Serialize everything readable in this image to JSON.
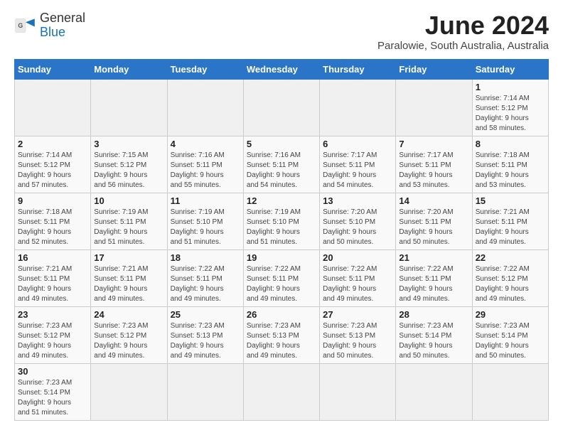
{
  "header": {
    "logo_line1": "General",
    "logo_line2": "Blue",
    "title": "June 2024",
    "subtitle": "Paralowie, South Australia, Australia"
  },
  "days_of_week": [
    "Sunday",
    "Monday",
    "Tuesday",
    "Wednesday",
    "Thursday",
    "Friday",
    "Saturday"
  ],
  "weeks": [
    [
      {
        "day": "",
        "info": ""
      },
      {
        "day": "",
        "info": ""
      },
      {
        "day": "",
        "info": ""
      },
      {
        "day": "",
        "info": ""
      },
      {
        "day": "",
        "info": ""
      },
      {
        "day": "",
        "info": ""
      },
      {
        "day": "1",
        "info": "Sunrise: 7:14 AM\nSunset: 5:12 PM\nDaylight: 9 hours\nand 58 minutes."
      }
    ],
    [
      {
        "day": "2",
        "info": "Sunrise: 7:14 AM\nSunset: 5:12 PM\nDaylight: 9 hours\nand 57 minutes."
      },
      {
        "day": "3",
        "info": "Sunrise: 7:15 AM\nSunset: 5:12 PM\nDaylight: 9 hours\nand 56 minutes."
      },
      {
        "day": "4",
        "info": "Sunrise: 7:16 AM\nSunset: 5:11 PM\nDaylight: 9 hours\nand 55 minutes."
      },
      {
        "day": "5",
        "info": "Sunrise: 7:16 AM\nSunset: 5:11 PM\nDaylight: 9 hours\nand 54 minutes."
      },
      {
        "day": "6",
        "info": "Sunrise: 7:17 AM\nSunset: 5:11 PM\nDaylight: 9 hours\nand 54 minutes."
      },
      {
        "day": "7",
        "info": "Sunrise: 7:17 AM\nSunset: 5:11 PM\nDaylight: 9 hours\nand 53 minutes."
      },
      {
        "day": "8",
        "info": "Sunrise: 7:18 AM\nSunset: 5:11 PM\nDaylight: 9 hours\nand 53 minutes."
      }
    ],
    [
      {
        "day": "9",
        "info": "Sunrise: 7:18 AM\nSunset: 5:11 PM\nDaylight: 9 hours\nand 52 minutes."
      },
      {
        "day": "10",
        "info": "Sunrise: 7:19 AM\nSunset: 5:11 PM\nDaylight: 9 hours\nand 51 minutes."
      },
      {
        "day": "11",
        "info": "Sunrise: 7:19 AM\nSunset: 5:10 PM\nDaylight: 9 hours\nand 51 minutes."
      },
      {
        "day": "12",
        "info": "Sunrise: 7:19 AM\nSunset: 5:10 PM\nDaylight: 9 hours\nand 51 minutes."
      },
      {
        "day": "13",
        "info": "Sunrise: 7:20 AM\nSunset: 5:10 PM\nDaylight: 9 hours\nand 50 minutes."
      },
      {
        "day": "14",
        "info": "Sunrise: 7:20 AM\nSunset: 5:11 PM\nDaylight: 9 hours\nand 50 minutes."
      },
      {
        "day": "15",
        "info": "Sunrise: 7:21 AM\nSunset: 5:11 PM\nDaylight: 9 hours\nand 49 minutes."
      }
    ],
    [
      {
        "day": "16",
        "info": "Sunrise: 7:21 AM\nSunset: 5:11 PM\nDaylight: 9 hours\nand 49 minutes."
      },
      {
        "day": "17",
        "info": "Sunrise: 7:21 AM\nSunset: 5:11 PM\nDaylight: 9 hours\nand 49 minutes."
      },
      {
        "day": "18",
        "info": "Sunrise: 7:22 AM\nSunset: 5:11 PM\nDaylight: 9 hours\nand 49 minutes."
      },
      {
        "day": "19",
        "info": "Sunrise: 7:22 AM\nSunset: 5:11 PM\nDaylight: 9 hours\nand 49 minutes."
      },
      {
        "day": "20",
        "info": "Sunrise: 7:22 AM\nSunset: 5:11 PM\nDaylight: 9 hours\nand 49 minutes."
      },
      {
        "day": "21",
        "info": "Sunrise: 7:22 AM\nSunset: 5:11 PM\nDaylight: 9 hours\nand 49 minutes."
      },
      {
        "day": "22",
        "info": "Sunrise: 7:22 AM\nSunset: 5:12 PM\nDaylight: 9 hours\nand 49 minutes."
      }
    ],
    [
      {
        "day": "23",
        "info": "Sunrise: 7:23 AM\nSunset: 5:12 PM\nDaylight: 9 hours\nand 49 minutes."
      },
      {
        "day": "24",
        "info": "Sunrise: 7:23 AM\nSunset: 5:12 PM\nDaylight: 9 hours\nand 49 minutes."
      },
      {
        "day": "25",
        "info": "Sunrise: 7:23 AM\nSunset: 5:13 PM\nDaylight: 9 hours\nand 49 minutes."
      },
      {
        "day": "26",
        "info": "Sunrise: 7:23 AM\nSunset: 5:13 PM\nDaylight: 9 hours\nand 49 minutes."
      },
      {
        "day": "27",
        "info": "Sunrise: 7:23 AM\nSunset: 5:13 PM\nDaylight: 9 hours\nand 50 minutes."
      },
      {
        "day": "28",
        "info": "Sunrise: 7:23 AM\nSunset: 5:14 PM\nDaylight: 9 hours\nand 50 minutes."
      },
      {
        "day": "29",
        "info": "Sunrise: 7:23 AM\nSunset: 5:14 PM\nDaylight: 9 hours\nand 50 minutes."
      }
    ],
    [
      {
        "day": "30",
        "info": "Sunrise: 7:23 AM\nSunset: 5:14 PM\nDaylight: 9 hours\nand 51 minutes."
      },
      {
        "day": "",
        "info": ""
      },
      {
        "day": "",
        "info": ""
      },
      {
        "day": "",
        "info": ""
      },
      {
        "day": "",
        "info": ""
      },
      {
        "day": "",
        "info": ""
      },
      {
        "day": "",
        "info": ""
      }
    ]
  ]
}
